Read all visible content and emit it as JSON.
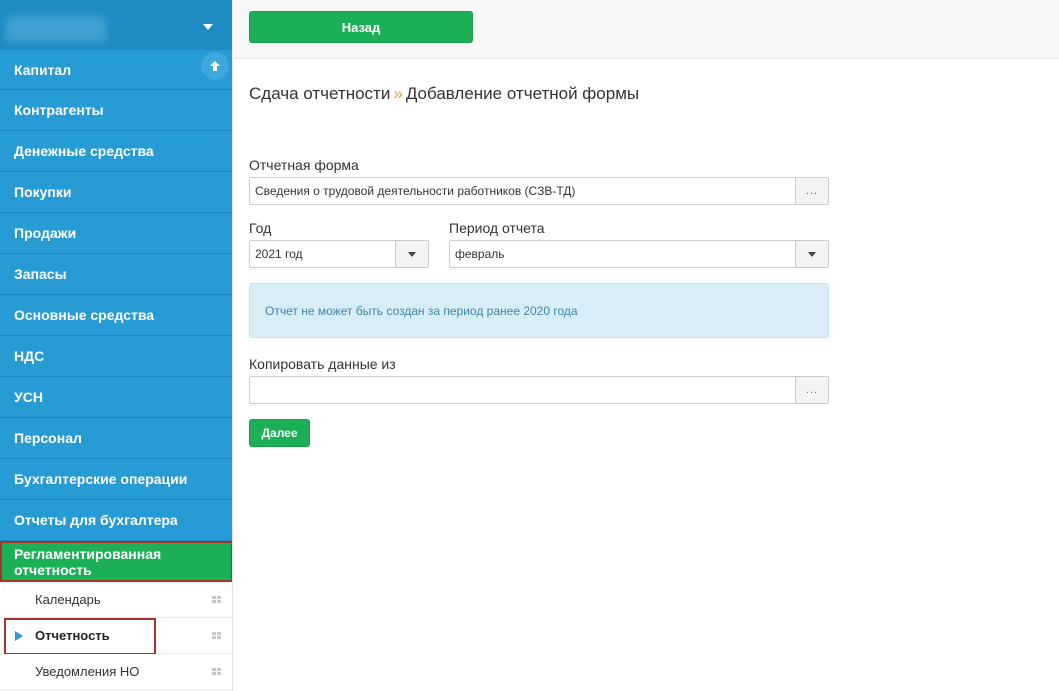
{
  "toolbar": {
    "back_label": "Назад"
  },
  "sidebar": {
    "items": [
      {
        "label": "Капитал"
      },
      {
        "label": "Контрагенты"
      },
      {
        "label": "Денежные средства"
      },
      {
        "label": "Покупки"
      },
      {
        "label": "Продажи"
      },
      {
        "label": "Запасы"
      },
      {
        "label": "Основные средства"
      },
      {
        "label": "НДС"
      },
      {
        "label": "УСН"
      },
      {
        "label": "Персонал"
      },
      {
        "label": "Бухгалтерские операции"
      },
      {
        "label": "Отчеты для бухгалтера"
      },
      {
        "label": "Регламентированная отчетность"
      }
    ],
    "sub_items": [
      {
        "label": "Календарь"
      },
      {
        "label": "Отчетность"
      },
      {
        "label": "Уведомления НО"
      }
    ]
  },
  "page": {
    "breadcrumb_root": "Сдача отчетности",
    "breadcrumb_sep": "»",
    "breadcrumb_current": "Добавление отчетной формы"
  },
  "form": {
    "report_form_label": "Отчетная форма",
    "report_form_value": "Сведения о трудовой деятельности работников (СЗВ-ТД)",
    "year_label": "Год",
    "year_value": "2021 год",
    "period_label": "Период отчета",
    "period_value": "февраль",
    "alert_text": "Отчет не может быть создан за период ранее 2020 года",
    "copy_label": "Копировать данные из",
    "copy_value": "",
    "picker_dots": "...",
    "next_label": "Далее"
  },
  "colors": {
    "accent_green": "#1cb056",
    "sidebar_blue": "#279bd4",
    "highlight_red": "#a8322b",
    "alert_bg": "#d9edf7"
  }
}
